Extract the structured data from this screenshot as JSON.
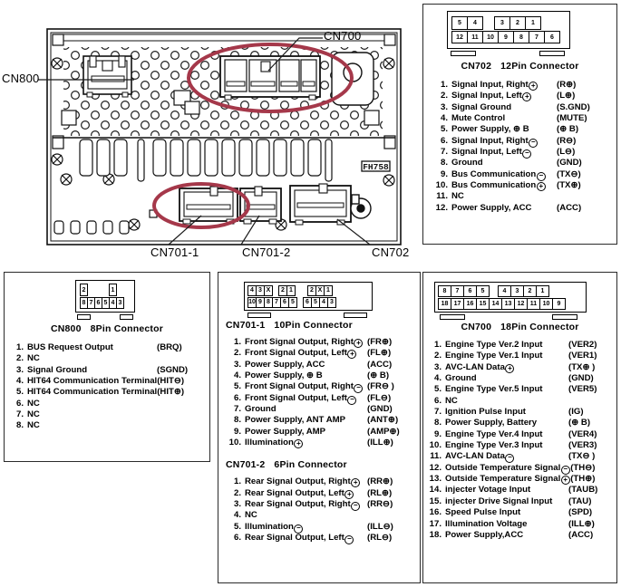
{
  "diagram": {
    "title_labels": {
      "cn800": "CN800",
      "cn700": "CN700",
      "cn701_1": "CN701-1",
      "cn701_2": "CN701-2",
      "cn702": "CN702"
    },
    "chassis_code": "FH758",
    "highlight_color": "#a5384a",
    "line_color": "#1a1a1a"
  },
  "panels": {
    "cn702": {
      "name": "CN702",
      "type": "12Pin Connector",
      "header_name": "CN702",
      "header_type": "12Pin Connector",
      "pinout_top": [
        "5",
        "4",
        "",
        "3",
        "2",
        "1"
      ],
      "pinout_bottom": [
        "12",
        "11",
        "10",
        "9",
        "8",
        "7",
        "6"
      ],
      "pins": [
        {
          "n": "1.",
          "name": "Signal Input, Right",
          "sign": "+",
          "code": "(R⊕)"
        },
        {
          "n": "2.",
          "name": "Signal Input, Left",
          "sign": "+",
          "code": "(L⊕)"
        },
        {
          "n": "3.",
          "name": "Signal Ground",
          "sign": "",
          "code": "(S.GND)"
        },
        {
          "n": "4.",
          "name": "Mute Control",
          "sign": "",
          "code": "(MUTE)"
        },
        {
          "n": "5.",
          "name": "Power Supply, ⊕ B",
          "sign": "",
          "code": "(⊕ B)"
        },
        {
          "n": "6.",
          "name": "Signal Input, Right",
          "sign": "-",
          "code": "(R⊖)"
        },
        {
          "n": "7.",
          "name": "Signal Input, Left",
          "sign": "-",
          "code": "(L⊖)"
        },
        {
          "n": "8.",
          "name": "Ground",
          "sign": "",
          "code": "(GND)"
        },
        {
          "n": "9.",
          "name": "Bus Communication",
          "sign": "-",
          "code": "(TX⊖)"
        },
        {
          "n": "10.",
          "name": "Bus Communication",
          "sign": "+",
          "code": "(TX⊕)"
        },
        {
          "n": "11.",
          "name": "NC",
          "sign": "",
          "code": ""
        },
        {
          "n": "12.",
          "name": "Power Supply, ACC",
          "sign": "",
          "code": "(ACC)"
        }
      ]
    },
    "cn800": {
      "header_name": "CN800",
      "header_type": "8Pin Connector",
      "pinout_top": [
        "2",
        "1"
      ],
      "pinout_bottom": [
        "8",
        "7",
        "6",
        "5",
        "4",
        "3"
      ],
      "pins": [
        {
          "n": "1.",
          "name": "BUS Request Output",
          "sign": "",
          "code": "(BRQ)"
        },
        {
          "n": "2.",
          "name": "NC",
          "sign": "",
          "code": ""
        },
        {
          "n": "3.",
          "name": "Signal Ground",
          "sign": "",
          "code": "(SGND)"
        },
        {
          "n": "4.",
          "name": "HIT64 Communication Terminal",
          "sign": "",
          "code": "(HIT⊖)"
        },
        {
          "n": "5.",
          "name": "HIT64 Communication Terminal",
          "sign": "",
          "code": "(HIT⊕)"
        },
        {
          "n": "6.",
          "name": "NC",
          "sign": "",
          "code": ""
        },
        {
          "n": "7.",
          "name": "NC",
          "sign": "",
          "code": ""
        },
        {
          "n": "8.",
          "name": "NC",
          "sign": "",
          "code": ""
        }
      ]
    },
    "cn701_1": {
      "header_name": "CN701-1",
      "header_type": "10Pin Connector",
      "pinout_top": [
        "4",
        "3",
        "X",
        "",
        "2",
        "1"
      ],
      "pinout_bottom": [
        "10",
        "9",
        "8",
        "7",
        "6",
        "5"
      ],
      "pins": [
        {
          "n": "1.",
          "name": "Front Signal Output, Right",
          "sign": "+",
          "code": "(FR⊕)"
        },
        {
          "n": "2.",
          "name": "Front Signal Output, Left",
          "sign": "+",
          "code": "(FL⊕)"
        },
        {
          "n": "3.",
          "name": "Power Supply, ACC",
          "sign": "",
          "code": "(ACC)"
        },
        {
          "n": "4.",
          "name": "Power Supply, ⊕ B",
          "sign": "",
          "code": "(⊕ B)"
        },
        {
          "n": "5.",
          "name": "Front Signal Output, Right",
          "sign": "-",
          "code": "(FR⊖ )"
        },
        {
          "n": "6.",
          "name": "Front Signal Output, Left",
          "sign": "-",
          "code": "(FL⊖)"
        },
        {
          "n": "7.",
          "name": "Ground",
          "sign": "",
          "code": "(GND)"
        },
        {
          "n": "8.",
          "name": "Power Supply, ANT AMP",
          "sign": "",
          "code": "(ANT⊕)"
        },
        {
          "n": "9.",
          "name": "Power Supply, AMP",
          "sign": "",
          "code": "(AMP⊕)"
        },
        {
          "n": "10.",
          "name": "Illumination",
          "sign": "+",
          "code": "(ILL⊕)"
        }
      ]
    },
    "cn701_2": {
      "header_name": "CN701-2",
      "header_type": "6Pin Connector",
      "pinout_top": [
        "2",
        "X",
        "1"
      ],
      "pinout_bottom": [
        "6",
        "5",
        "4",
        "3"
      ],
      "pins": [
        {
          "n": "1.",
          "name": "Rear Signal Output, Right",
          "sign": "+",
          "code": "(RR⊕)"
        },
        {
          "n": "2.",
          "name": "Rear Signal Output, Left",
          "sign": "+",
          "code": "(RL⊕)"
        },
        {
          "n": "3.",
          "name": "Rear Signal Output, Right",
          "sign": "-",
          "code": "(RR⊖)"
        },
        {
          "n": "4.",
          "name": "NC",
          "sign": "",
          "code": ""
        },
        {
          "n": "5.",
          "name": "Illumination",
          "sign": "-",
          "code": "(ILL⊖)"
        },
        {
          "n": "6.",
          "name": "Rear Signal Output, Left",
          "sign": "-",
          "code": "(RL⊖)"
        }
      ]
    },
    "cn700": {
      "header_name": "CN700",
      "header_type": "18Pin Connector",
      "pinout_top": [
        "8",
        "7",
        "6",
        "5",
        "",
        "4",
        "3",
        "2",
        "1"
      ],
      "pinout_bottom": [
        "18",
        "17",
        "16",
        "15",
        "14",
        "13",
        "12",
        "11",
        "10",
        "9"
      ],
      "pins": [
        {
          "n": "1.",
          "name": "Engine Type Ver.2 Input",
          "sign": "",
          "code": "(VER2)"
        },
        {
          "n": "2.",
          "name": "Engine Type Ver.1 Input",
          "sign": "",
          "code": "(VER1)"
        },
        {
          "n": "3.",
          "name": "AVC-LAN Data",
          "sign": "+",
          "code": "(TX⊕ )"
        },
        {
          "n": "4.",
          "name": "Ground",
          "sign": "",
          "code": "(GND)"
        },
        {
          "n": "5.",
          "name": "Engine Type Ver.5 Input",
          "sign": "",
          "code": "(VER5)"
        },
        {
          "n": "6.",
          "name": "NC",
          "sign": "",
          "code": ""
        },
        {
          "n": "7.",
          "name": "Ignition Pulse Input",
          "sign": "",
          "code": "(IG)"
        },
        {
          "n": "8.",
          "name": "Power Supply, Battery",
          "sign": "",
          "code": "(⊕ B)"
        },
        {
          "n": "9.",
          "name": "Engine Type Ver.4 Input",
          "sign": "",
          "code": "(VER4)"
        },
        {
          "n": "10.",
          "name": "Engine Type Ver.3 Input",
          "sign": "",
          "code": "(VER3)"
        },
        {
          "n": "11.",
          "name": "AVC-LAN Data",
          "sign": "-",
          "code": "(TX⊖ )"
        },
        {
          "n": "12.",
          "name": "Outside Temperature Signal",
          "sign": "-",
          "code": "(TH⊖)"
        },
        {
          "n": "13.",
          "name": "Outside Temperature Signal",
          "sign": "+",
          "code": "(TH⊕)"
        },
        {
          "n": "14.",
          "name": "injecter Votage Input",
          "sign": "",
          "code": "(TAUB)"
        },
        {
          "n": "15.",
          "name": "injecter Drive Signal Input",
          "sign": "",
          "code": "(TAU)"
        },
        {
          "n": "16.",
          "name": "Speed Pulse Input",
          "sign": "",
          "code": "(SPD)"
        },
        {
          "n": "17.",
          "name": "Illumination Voltage",
          "sign": "",
          "code": "(ILL⊕)"
        },
        {
          "n": "18.",
          "name": "Power Supply,ACC",
          "sign": "",
          "code": "(ACC)"
        }
      ]
    }
  }
}
